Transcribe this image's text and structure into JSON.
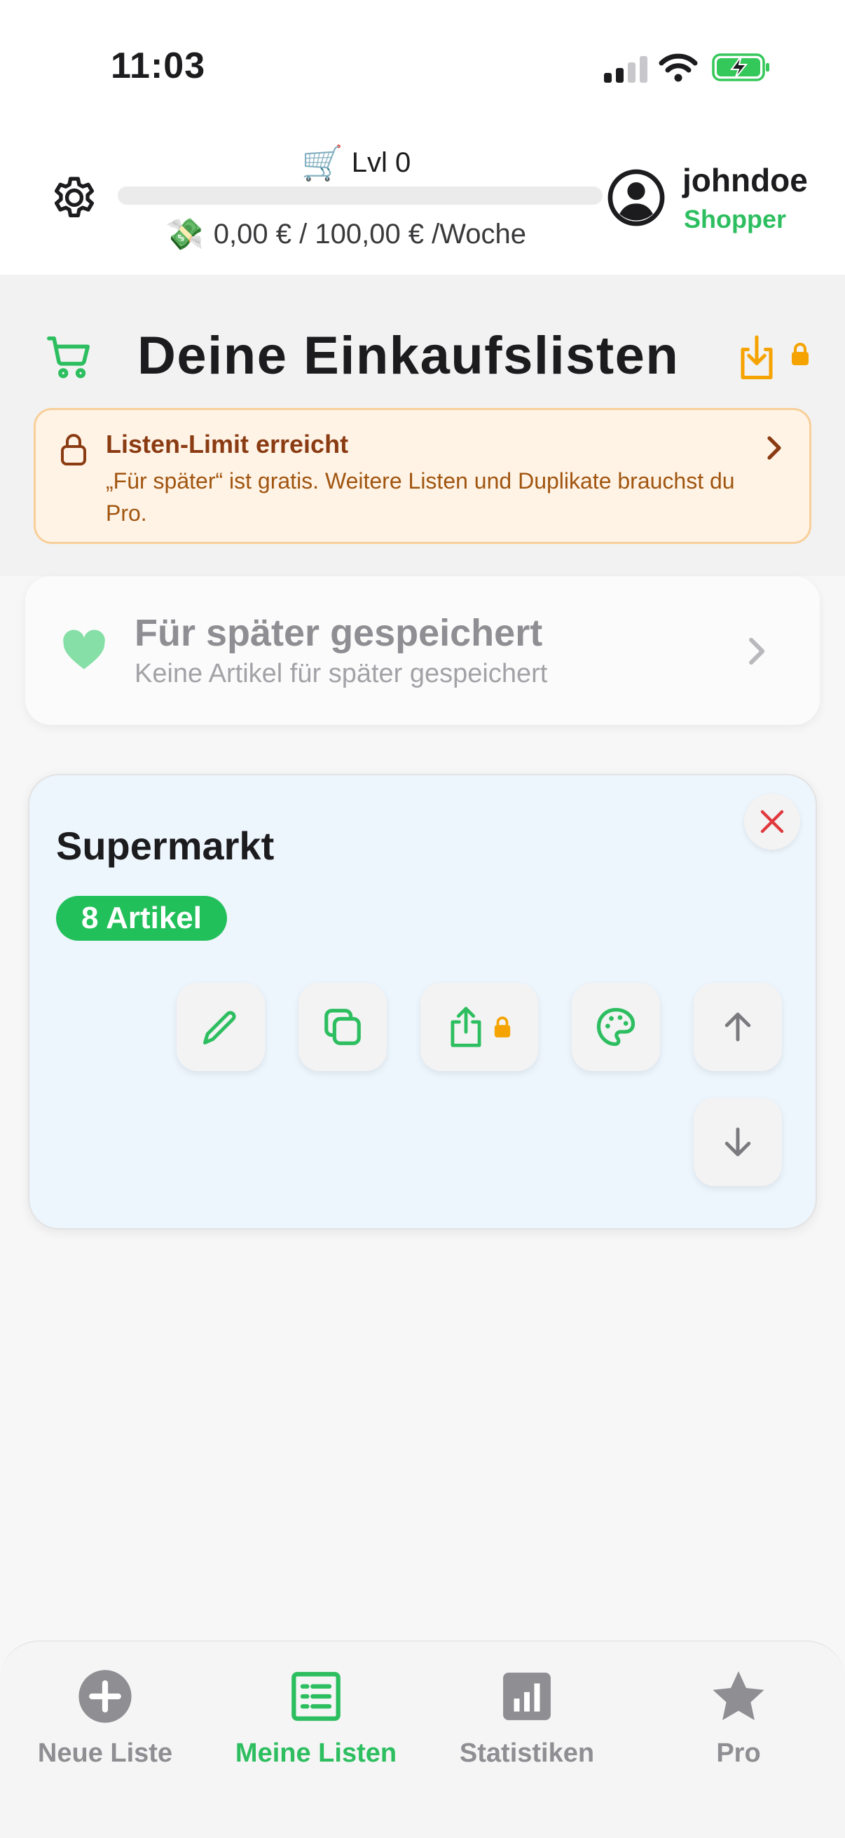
{
  "status_bar": {
    "time": "11:03"
  },
  "header": {
    "level_label": "Lvl 0",
    "progress": 0,
    "budget": "0,00 € / 100,00 € /Woche",
    "username": "johndoe",
    "role": "Shopper"
  },
  "main": {
    "title": "Deine Einkaufslisten",
    "limit_banner": {
      "title": "Listen-Limit erreicht",
      "text": "„Für später“ ist gratis. Weitere Listen und Duplikate brauchst du Pro."
    },
    "saved_for_later": {
      "title": "Für später gespeichert",
      "subtitle": "Keine Artikel für später gespeichert"
    },
    "lists": [
      {
        "name": "Supermarkt",
        "count_label": "8 Artikel"
      }
    ]
  },
  "tabbar": {
    "items": [
      {
        "label": "Neue Liste",
        "icon": "plus-circle-icon",
        "active": false
      },
      {
        "label": "Meine Listen",
        "icon": "list-icon",
        "active": true
      },
      {
        "label": "Statistiken",
        "icon": "chart-icon",
        "active": false
      },
      {
        "label": "Pro",
        "icon": "star-icon",
        "active": false
      }
    ]
  },
  "colors": {
    "accent": "#2dbe60",
    "warning_bg": "#fff3e6",
    "warning_text": "#8a3b12",
    "lock": "#f5a300",
    "delete": "#e0393e",
    "card_bg": "#edf5fd"
  }
}
